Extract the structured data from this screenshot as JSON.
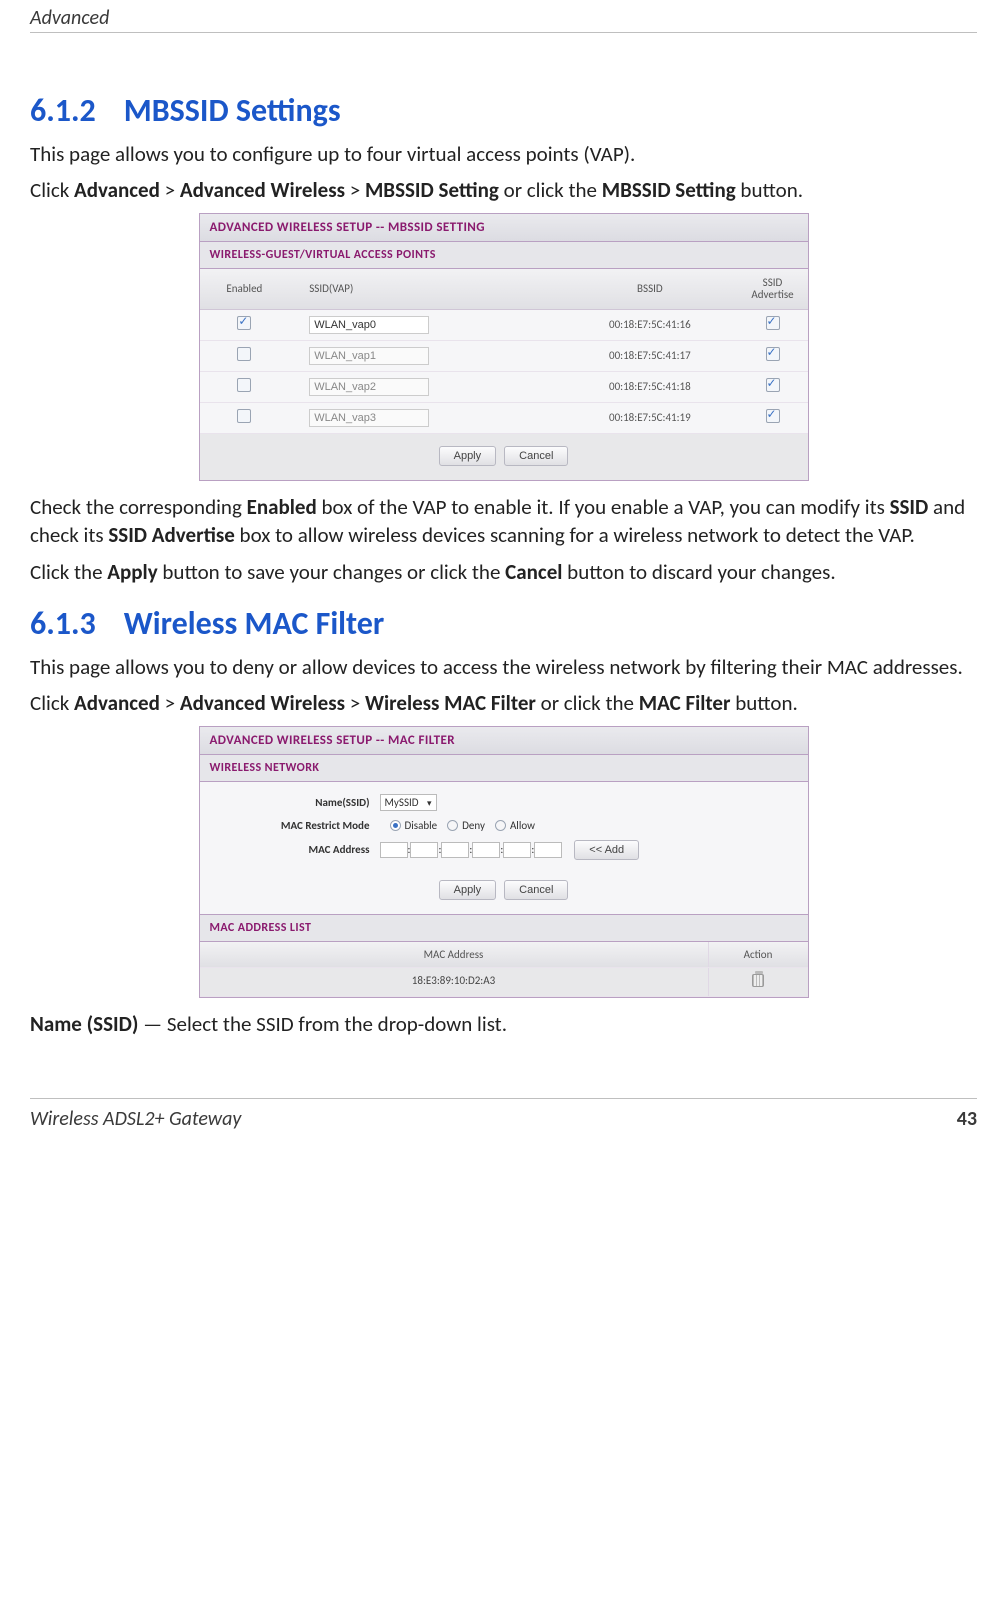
{
  "header": {
    "title": "Advanced"
  },
  "footer": {
    "product": "Wireless ADSL2+ Gateway",
    "page": "43"
  },
  "s612": {
    "num": "6.1.2",
    "title": "MBSSID Settings",
    "p1": "This page allows you to configure up to four virtual access points (VAP).",
    "p2a": "Click ",
    "p2b": "Advanced",
    "p2c": " > ",
    "p2d": "Advanced Wireless",
    "p2e": " > ",
    "p2f": "MBSSID Setting",
    "p2g": " or click the ",
    "p2h": "MBSSID Setting",
    "p2i": " button.",
    "p3a": "Check the corresponding ",
    "p3b": "Enabled",
    "p3c": " box of the VAP to enable it. If you enable a VAP, you can modify its ",
    "p3d": "SSID",
    "p3e": " and check its ",
    "p3f": "SSID Advertise",
    "p3g": " box to allow wireless devices scanning for a wireless network to detect the VAP.",
    "p4a": "Click the ",
    "p4b": "Apply",
    "p4c": " button to save your changes or click the ",
    "p4d": "Cancel",
    "p4e": " button to discard your changes."
  },
  "mbssid_panel": {
    "title": "ADVANCED WIRELESS SETUP -- MBSSID SETTING",
    "subtitle": "WIRELESS-GUEST/VIRTUAL ACCESS POINTS",
    "cols": {
      "enabled": "Enabled",
      "ssid": "SSID(VAP)",
      "bssid": "BSSID",
      "adv": "SSID Advertise"
    },
    "rows": [
      {
        "enabled": true,
        "ssid": "WLAN_vap0",
        "bssid": "00:18:E7:5C:41:16",
        "adv": true,
        "active": true
      },
      {
        "enabled": false,
        "ssid": "WLAN_vap1",
        "bssid": "00:18:E7:5C:41:17",
        "adv": true,
        "active": false
      },
      {
        "enabled": false,
        "ssid": "WLAN_vap2",
        "bssid": "00:18:E7:5C:41:18",
        "adv": true,
        "active": false
      },
      {
        "enabled": false,
        "ssid": "WLAN_vap3",
        "bssid": "00:18:E7:5C:41:19",
        "adv": true,
        "active": false
      }
    ],
    "apply": "Apply",
    "cancel": "Cancel"
  },
  "s613": {
    "num": "6.1.3",
    "title": "Wireless MAC Filter",
    "p1": "This page allows you to deny or allow devices to access the wireless network by filtering their MAC addresses.",
    "p2a": "Click ",
    "p2b": "Advanced",
    "p2c": " > ",
    "p2d": "Advanced Wireless",
    "p2e": " > ",
    "p2f": "Wireless MAC Filter",
    "p2g": " or click the ",
    "p2h": "MAC Filter",
    "p2i": " button.",
    "p3a": "Name (SSID)",
    "p3b": " — Select the SSID from the drop-down list."
  },
  "mac_panel": {
    "title": "ADVANCED WIRELESS SETUP -- MAC FILTER",
    "section": "WIRELESS NETWORK",
    "name_label": "Name(SSID)",
    "name_value": "MySSID",
    "mode_label": "MAC Restrict Mode",
    "mode_options": {
      "disable": "Disable",
      "deny": "Deny",
      "allow": "Allow"
    },
    "mode_selected": "disable",
    "addr_label": "MAC Address",
    "add_btn": "<< Add",
    "apply": "Apply",
    "cancel": "Cancel",
    "list_title": "MAC ADDRESS LIST",
    "list_cols": {
      "addr": "MAC Address",
      "action": "Action"
    },
    "list_rows": [
      {
        "addr": "18:E3:89:10:D2:A3"
      }
    ]
  }
}
